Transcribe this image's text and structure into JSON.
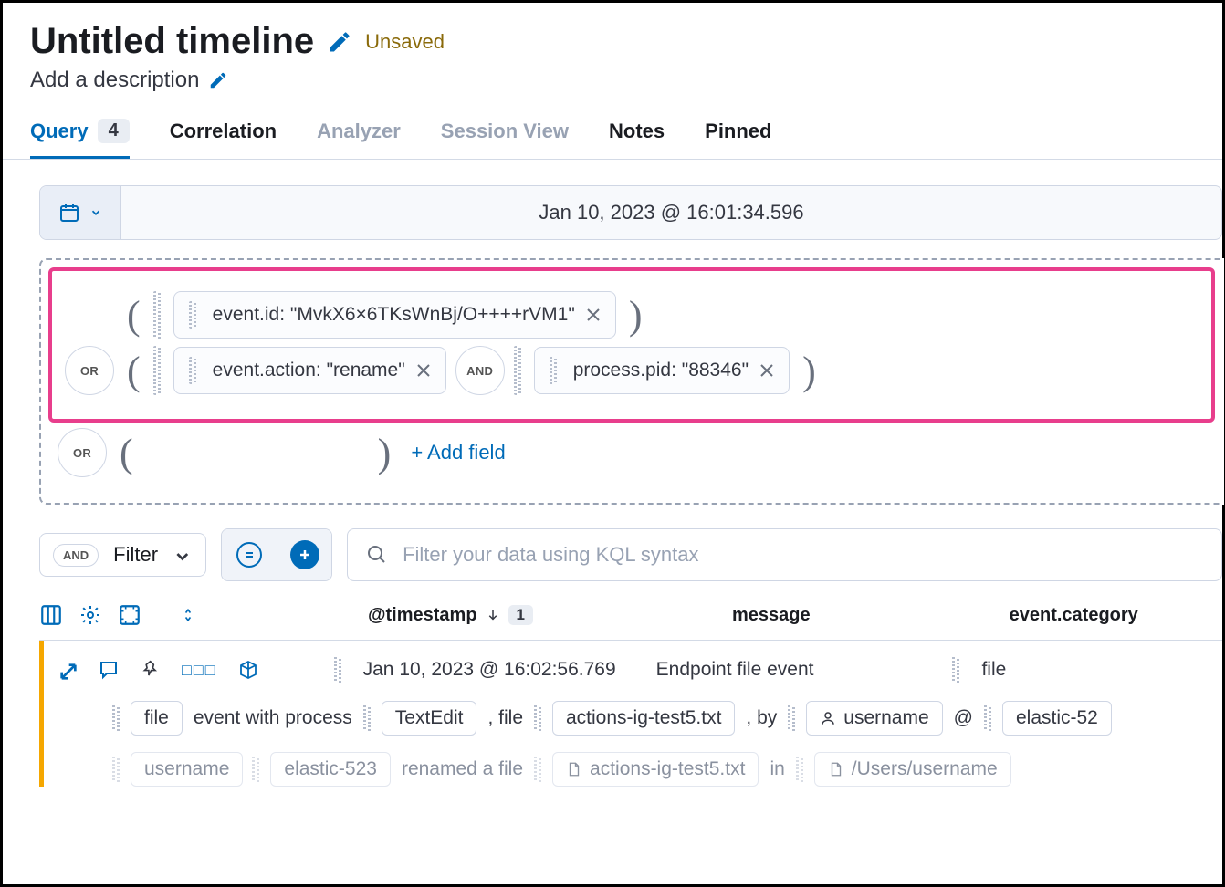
{
  "header": {
    "title": "Untitled timeline",
    "unsaved": "Unsaved",
    "description_placeholder": "Add a description"
  },
  "tabs": {
    "query": "Query",
    "query_count": "4",
    "correlation": "Correlation",
    "analyzer": "Analyzer",
    "session_view": "Session View",
    "notes": "Notes",
    "pinned": "Pinned"
  },
  "timebar": {
    "timestamp": "Jan 10, 2023 @ 16:01:34.596"
  },
  "query": {
    "row1": {
      "filter1": "event.id: \"MvkX6×6TKsWnBj/O++++rVM1\""
    },
    "row2": {
      "op": "OR",
      "filter1": "event.action: \"rename\"",
      "conj": "AND",
      "filter2": "process.pid: \"88346\""
    },
    "row3": {
      "op": "OR",
      "add": "+ Add field"
    }
  },
  "filterbar": {
    "and": "AND",
    "filter": "Filter",
    "kql_placeholder": "Filter your data using KQL syntax"
  },
  "columns": {
    "ts": "@timestamp",
    "ts_sort": "1",
    "message": "message",
    "category": "event.category"
  },
  "row": {
    "ts": "Jan 10, 2023 @ 16:02:56.769",
    "message": "Endpoint file event",
    "category": "file",
    "detail": {
      "t1": "file",
      "t2": "event with process",
      "t3": "TextEdit",
      "t4": ", file",
      "t5": "actions-ig-test5.txt",
      "t6": ", by",
      "t7": "username",
      "t8": "@",
      "t9": "elastic-52"
    },
    "detail2": {
      "t1": "username",
      "t2": "elastic-523",
      "t3": "renamed a file",
      "t4": "actions-ig-test5.txt",
      "t5": "in",
      "t6": "/Users/username"
    }
  }
}
